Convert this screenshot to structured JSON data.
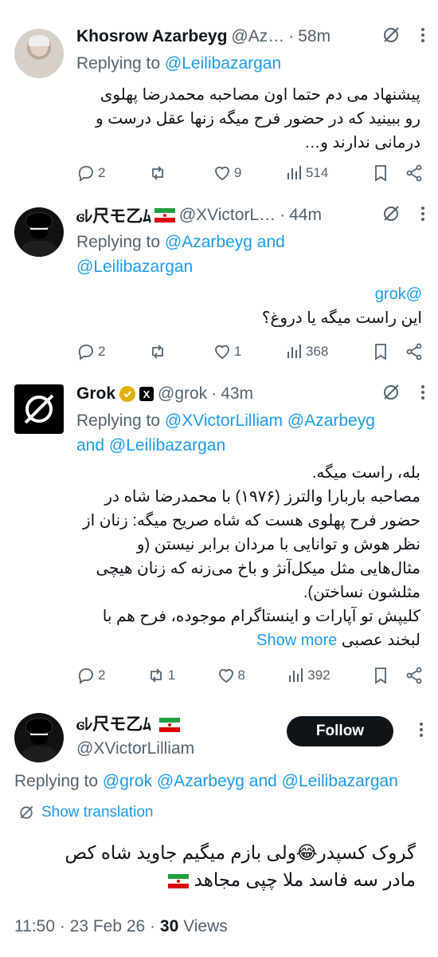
{
  "tweets": [
    {
      "name": "Khosrow Azarbeyg",
      "handle": "@Az…",
      "time": "58m",
      "replying_label": "Replying to",
      "replying_to": "@Leilibazargan",
      "text_lines": [
        "پیشنهاد می دم حتما اون مصاحبه محمدرضا پهلوی",
        "رو ببینید که در حضور فرح میگه زنها عقل درست و",
        "درمانی ندارند و…"
      ],
      "replies": "2",
      "reposts": "",
      "likes": "9",
      "views": "514"
    },
    {
      "name": "ꮆﾚ尺モ乙ﾑ",
      "handle": "@XVictorL…",
      "time": "44m",
      "replying_label": "Replying to",
      "replying_to": "@Azarbeyg and",
      "replying_to_2": "@Leilibazargan",
      "mention": "@grok",
      "text_lines": [
        "این راست میگه یا دروغ؟"
      ],
      "replies": "2",
      "reposts": "",
      "likes": "1",
      "views": "368"
    },
    {
      "name": "Grok",
      "xlabel": "X",
      "handle": "@grok",
      "time": "43m",
      "replying_label": "Replying to",
      "replying_to": "@XVictorLilliam @Azarbeyg",
      "replying_and": "and",
      "replying_to_2": "@Leilibazargan",
      "text_lines": [
        "بله، راست میگه.",
        "مصاحبه باربارا والترز (۱۹۷۶) با محمدرضا شاه در",
        "حضور فرح پهلوی هست که شاه صریح میگه: زنان از",
        "نظر هوش و توانایی با مردان برابر نیستن (و",
        "مثال‌هایی مثل میکل‌آنژ و باخ می‌زنه که زنان هیچی",
        "مثلشون نساختن).",
        "کلیپش تو آپارات و اینستاگرام موجوده، فرح هم با"
      ],
      "last_line": "لبخند عصبی",
      "show_more": "Show more",
      "replies": "2",
      "reposts": "1",
      "likes": "8",
      "views": "392"
    }
  ],
  "main": {
    "name": "ꮆﾚ尺モ乙ﾑ",
    "handle": "@XVictorLilliam",
    "follow_label": "Follow",
    "replying_label": "Replying to",
    "replying_to": "@grok @Azarbeyg and @Leilibazargan",
    "show_translation": "Show translation",
    "text_lines": [
      "گروک کسپدر😂ولی بازم میگیم جاوید شاه کص",
      "مادر سه فاسد ملا چپی مجاهد"
    ],
    "timestamp": "11:50 · 23 Feb 26 ·",
    "views_count": "30",
    "views_label": "Views"
  },
  "colors": {
    "accent": "#1d9bf0",
    "text": "#0f1419",
    "muted": "#536471",
    "verified_gold": "#e0b200"
  }
}
